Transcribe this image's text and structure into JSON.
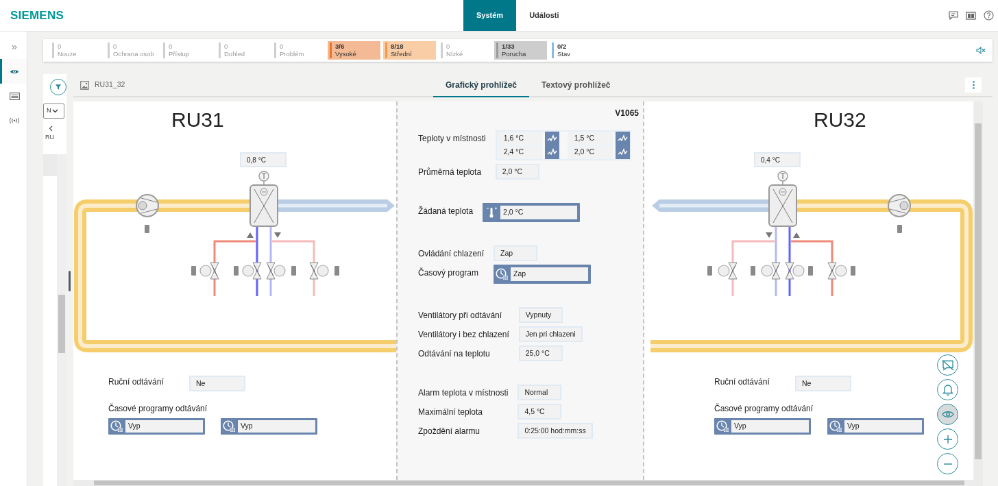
{
  "header": {
    "logo": "SIEMENS",
    "tabs": [
      {
        "label": "Systém",
        "selected": true
      },
      {
        "label": "Události",
        "selected": false
      }
    ]
  },
  "rail": {
    "expand": "»",
    "items": [
      {
        "kind": "eye",
        "selected": true
      },
      {
        "kind": "list",
        "selected": false
      },
      {
        "kind": "signal",
        "selected": false
      }
    ]
  },
  "summary": {
    "items": [
      {
        "count": "0",
        "label": "Nouze",
        "color": "#cfcfcf",
        "active": false,
        "highlighted": false
      },
      {
        "count": "0",
        "label": "Ochrana osob",
        "color": "#cfcfcf",
        "active": false,
        "highlighted": false
      },
      {
        "count": "0",
        "label": "Přístup",
        "color": "#cfcfcf",
        "active": false,
        "highlighted": false
      },
      {
        "count": "0",
        "label": "Dohled",
        "color": "#cfcfcf",
        "active": false,
        "highlighted": false
      },
      {
        "count": "0",
        "label": "Problém",
        "color": "#cfcfcf",
        "active": false,
        "highlighted": false
      },
      {
        "count": "3/6",
        "label": "Vysoké",
        "color": "#e8742a",
        "active": true,
        "highlighted": true
      },
      {
        "count": "8/18",
        "label": "Střední",
        "color": "#f39a4c",
        "active": true,
        "highlighted": true
      },
      {
        "count": "0",
        "label": "Nízké",
        "color": "#cfcfcf",
        "active": false,
        "highlighted": false
      },
      {
        "count": "1/33",
        "label": "Porucha",
        "color": "#9a9a9a",
        "active": true,
        "highlighted": true
      },
      {
        "count": "0/2",
        "label": "Stav",
        "color": "#86bde6",
        "active": true,
        "highlighted": false
      }
    ]
  },
  "side_panel": {
    "dropdown": "N",
    "breadcrumb": "RU"
  },
  "viewer": {
    "title": "RU31_32",
    "tabs": [
      {
        "label": "Grafický prohlížeč",
        "selected": true
      },
      {
        "label": "Textový prohlížeč",
        "selected": false
      }
    ]
  },
  "units": [
    {
      "kind": "left",
      "name": "RU31",
      "sensor_value": "0,8 °C",
      "sensor_label": "T",
      "manual_defrost": {
        "label": "Ruční odtávání",
        "value": "Ne"
      },
      "defrost_schedules": {
        "label": "Časové programy odtávání",
        "values": [
          "Vyp",
          "Vyp"
        ]
      }
    },
    {
      "kind": "right",
      "name": "RU32",
      "sensor_value": "0,4 °C",
      "sensor_label": "T",
      "manual_defrost": {
        "label": "Ruční odtávání",
        "value": "Ne"
      },
      "defrost_schedules": {
        "label": "Časové programy odtávání",
        "values": [
          "Vyp",
          "Vyp"
        ]
      }
    }
  ],
  "center": {
    "code": "V1065",
    "sections": [
      {
        "rows": [
          {
            "kind": "trend",
            "label": "Teploty v místnosti",
            "values": [
              "1,6 °C",
              "1,5 °C",
              "2,4 °C",
              "2,0 °C"
            ]
          },
          {
            "kind": "value",
            "label": "Průměrná teplota",
            "value": "2,0 °C"
          }
        ]
      },
      {
        "rows": [
          {
            "kind": "setpoint",
            "label": "Žádaná teplota",
            "value": "2,0 °C"
          }
        ]
      },
      {
        "rows": [
          {
            "kind": "value",
            "label": "Ovládání chlazení",
            "value": "Zap"
          },
          {
            "kind": "schedule",
            "label": "Časový program",
            "value": "Zap"
          }
        ]
      },
      {
        "rows": [
          {
            "kind": "value",
            "label": "Ventilátory při odtávání",
            "value": "Vypnuty"
          },
          {
            "kind": "value",
            "label": "Ventilátory i bez chlazení",
            "value": "Jen pri chlazeni"
          },
          {
            "kind": "value",
            "label": "Odtávání na teplotu",
            "value": "25,0 °C"
          }
        ]
      },
      {
        "rows": [
          {
            "kind": "value",
            "label": "Alarm teplota v místnosti",
            "value": "Normal"
          },
          {
            "kind": "value",
            "label": "Maximální teplota",
            "value": "4,5 °C"
          },
          {
            "kind": "value",
            "label": "Zpoždění alarmu",
            "value": "0:25:00 hod:mm:ss"
          }
        ]
      }
    ]
  },
  "map_controls": [
    {
      "kind": "no-message",
      "selected": false
    },
    {
      "kind": "bell",
      "selected": false
    },
    {
      "kind": "eye",
      "selected": true
    },
    {
      "kind": "zoom-in",
      "selected": false
    },
    {
      "kind": "zoom-out",
      "selected": false
    }
  ]
}
